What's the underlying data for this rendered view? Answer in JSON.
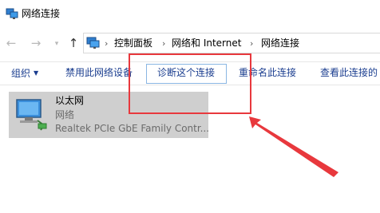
{
  "window": {
    "title": "网络连接"
  },
  "navigation": {
    "breadcrumbs": [
      "控制面板",
      "网络和 Internet",
      "网络连接"
    ]
  },
  "commandbar": {
    "organize": "组织",
    "disable": "禁用此网络设备",
    "diagnose": "诊断这个连接",
    "rename": "重命名此连接",
    "view_status": "查看此连接的"
  },
  "connection": {
    "name": "以太网",
    "status": "网络",
    "adapter": "Realtek PCIe GbE Family Contr..."
  },
  "colors": {
    "annotation": "#e8383d",
    "command_text": "#1a3d8f",
    "selected_item": "#cfcfcf"
  },
  "icons": {
    "title": "network-connections-icon",
    "address": "control-panel-icon",
    "item": "ethernet-adapter-icon"
  }
}
